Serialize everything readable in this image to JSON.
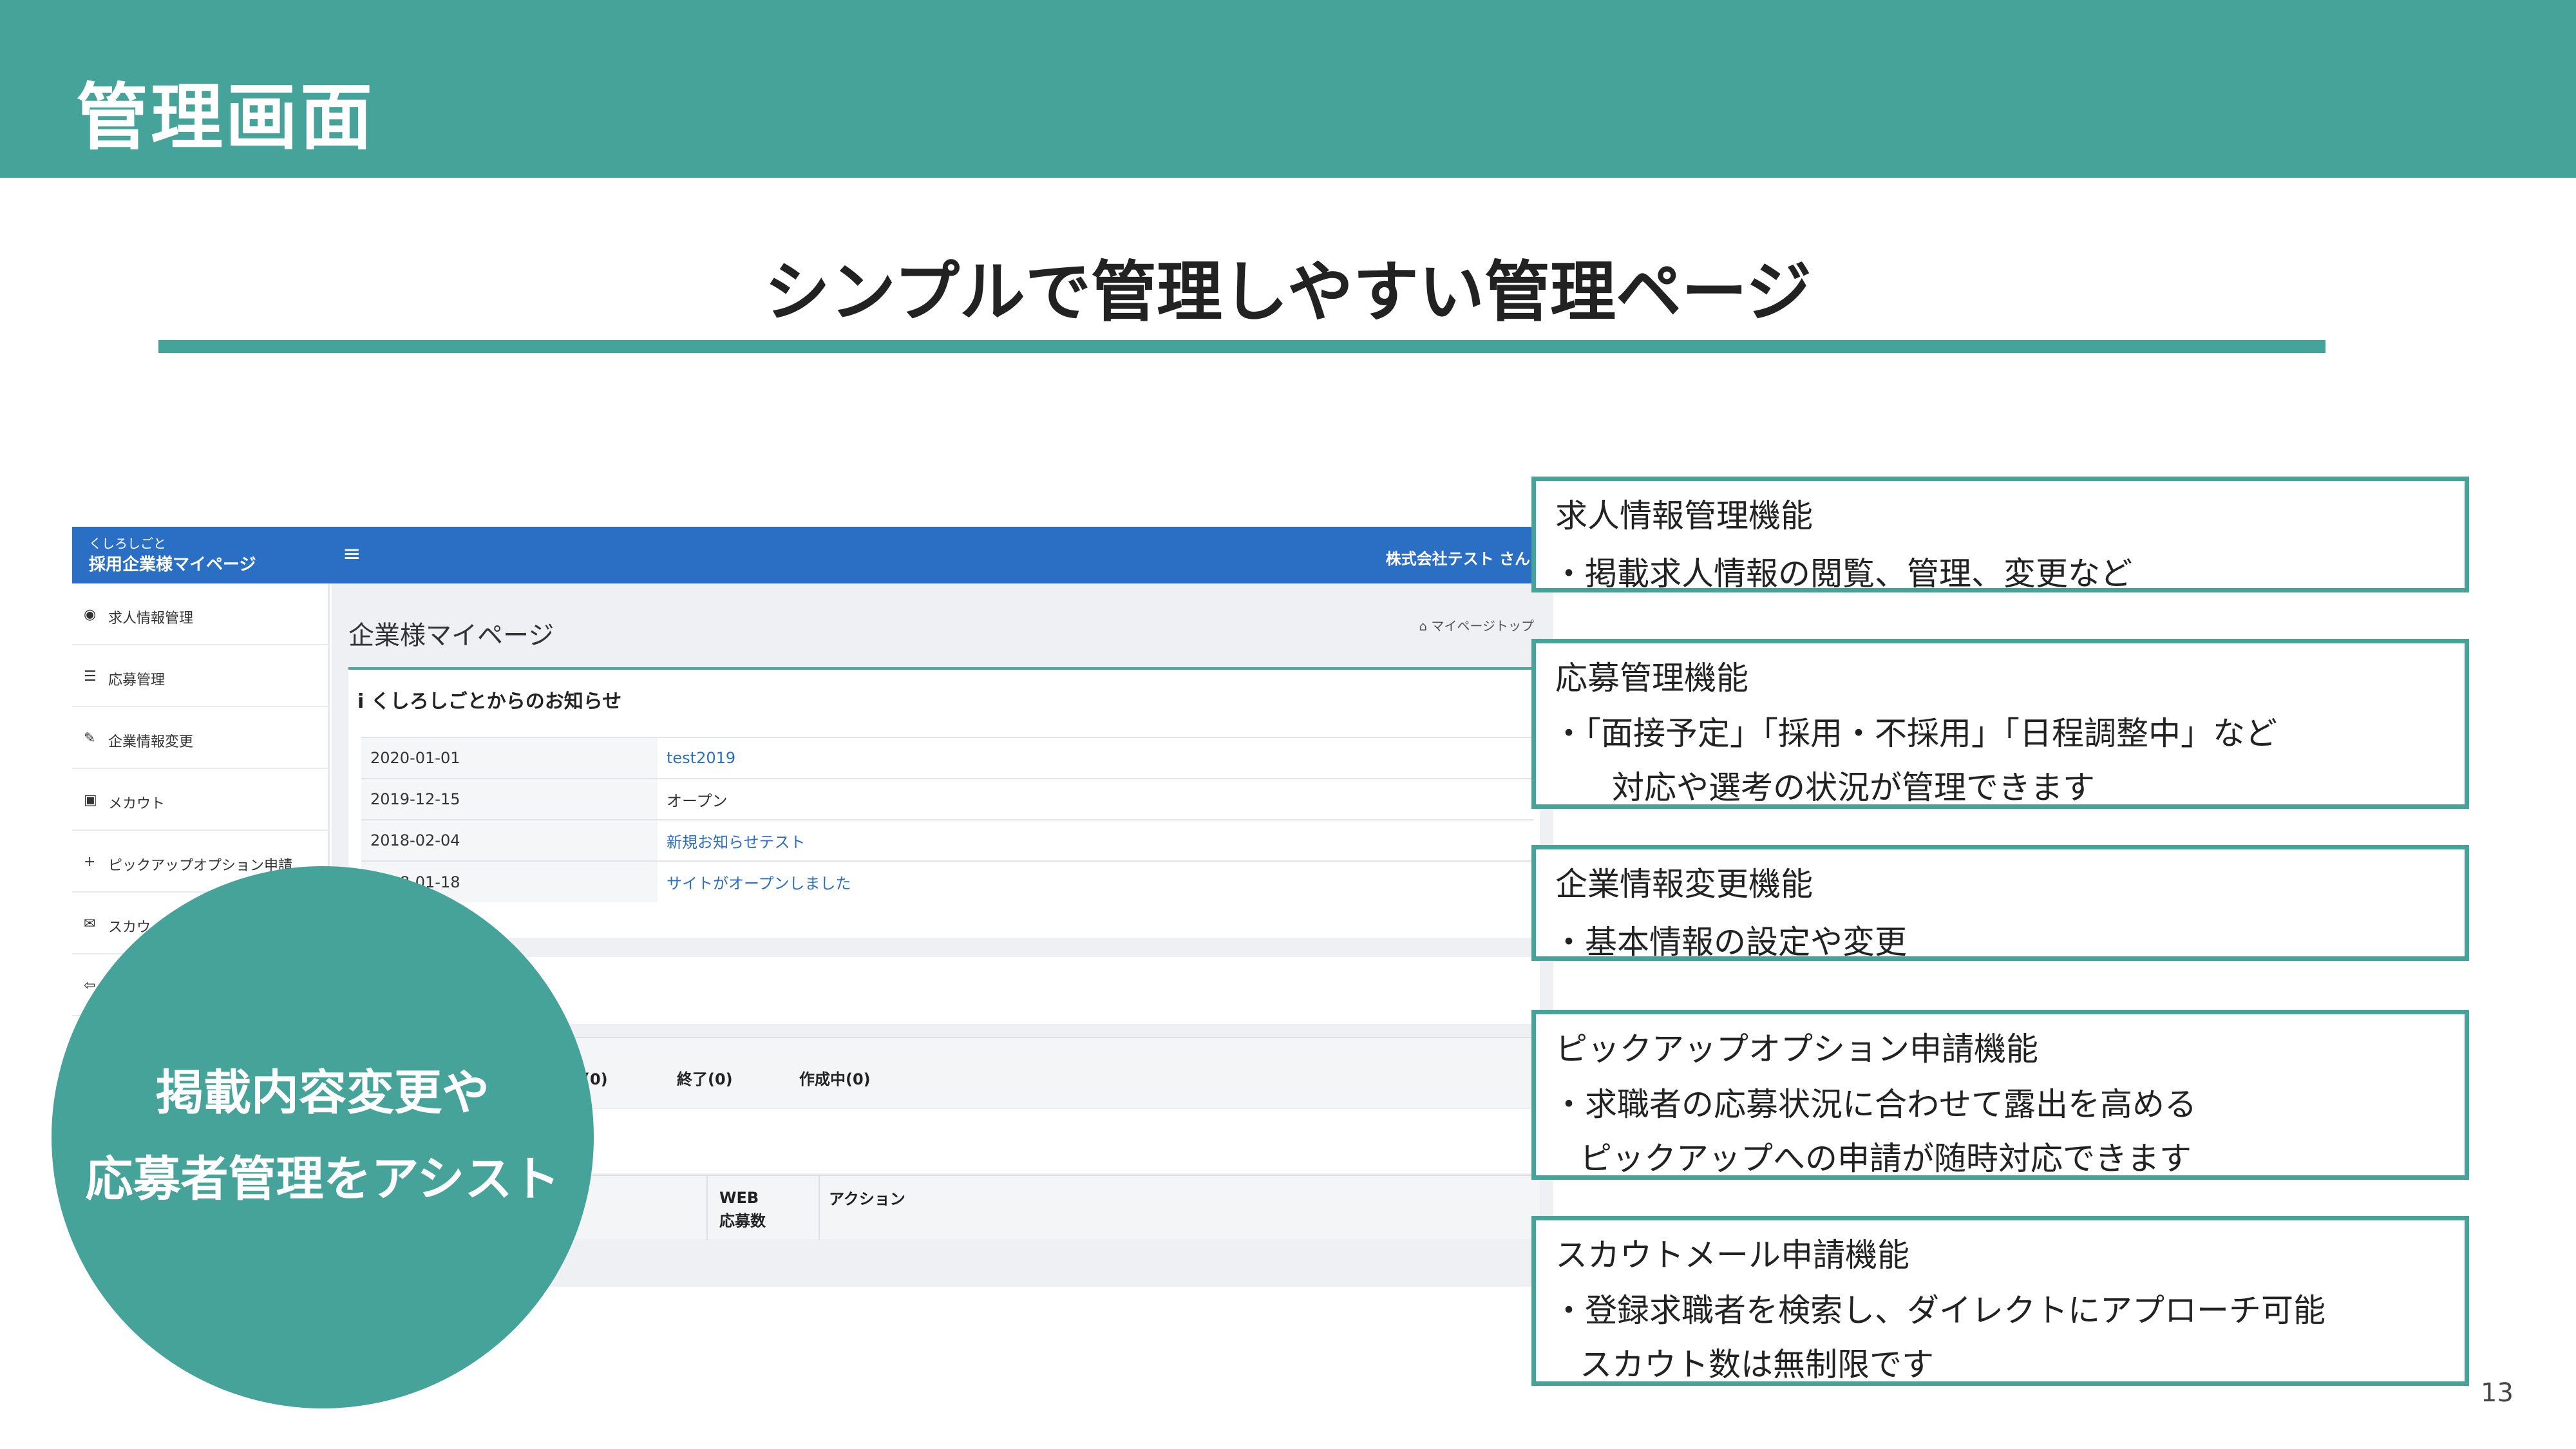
{
  "header": {
    "title": "管理画面"
  },
  "subtitle": "シンプルで管理しやすい管理ページ",
  "mockup": {
    "brand_small": "くしろしごと",
    "brand": "採用企業様マイページ",
    "menu_icon": "≡",
    "company": "株式会社テスト さん",
    "sidebar": [
      {
        "icon": "dashboard-icon",
        "glyph": "◉",
        "label": "求人情報管理"
      },
      {
        "icon": "list-icon",
        "glyph": "☰",
        "label": "応募管理"
      },
      {
        "icon": "edit-icon",
        "glyph": "✎",
        "label": "企業情報変更"
      },
      {
        "icon": "user-icon",
        "glyph": "▣",
        "label": "メカウト"
      },
      {
        "icon": "plus-icon",
        "glyph": "+",
        "label": "ピックアップオプション申請"
      },
      {
        "icon": "mail-icon",
        "glyph": "✉",
        "label": "スカウ"
      },
      {
        "icon": "logout-icon",
        "glyph": "⇦",
        "label": ""
      }
    ],
    "page_title": "企業様マイページ",
    "breadcrumb": "マイページトップ",
    "news_title": "くしろしごとからのお知らせ",
    "news": [
      {
        "date": "2020-01-01",
        "text": "test2019",
        "link": true
      },
      {
        "date": "2019-12-15",
        "text": "オープン",
        "link": false
      },
      {
        "date": "2018-02-04",
        "text": "新規お知らせテスト",
        "link": true
      },
      {
        "date": "2018-01-18",
        "text": "サイトがオープンしました",
        "link": true
      }
    ],
    "status_partial": "ら(0)",
    "status_ended": "終了(0)",
    "status_draft": "作成中(0)",
    "col_web": "WEB",
    "col_web2": "応募数",
    "col_action": "アクション"
  },
  "circle": {
    "line1": "掲載内容変更や",
    "line2": "応募者管理をアシスト"
  },
  "features": [
    {
      "title": "求人情報管理機能",
      "lines": [
        "・掲載求人情報の閲覧、管理、変更など"
      ]
    },
    {
      "title": "応募管理機能",
      "lines": [
        "・「面接予定」「採用・不採用」「日程調整中」など",
        "対応や選考の状況が管理できます"
      ]
    },
    {
      "title": "企業情報変更機能",
      "lines": [
        "・基本情報の設定や変更"
      ]
    },
    {
      "title": "ピックアップオプション申請機能",
      "lines": [
        "・求職者の応募状況に合わせて露出を高める",
        "ピックアップへの申請が随時対応できます"
      ]
    },
    {
      "title": "スカウトメール申請機能",
      "lines": [
        "・登録求職者を検索し、ダイレクトにアプローチ可能",
        "スカウト数は無制限です"
      ]
    }
  ],
  "page_number": "13",
  "colors": {
    "accent": "#45a39a",
    "mock_bar": "#2b6fc4"
  }
}
